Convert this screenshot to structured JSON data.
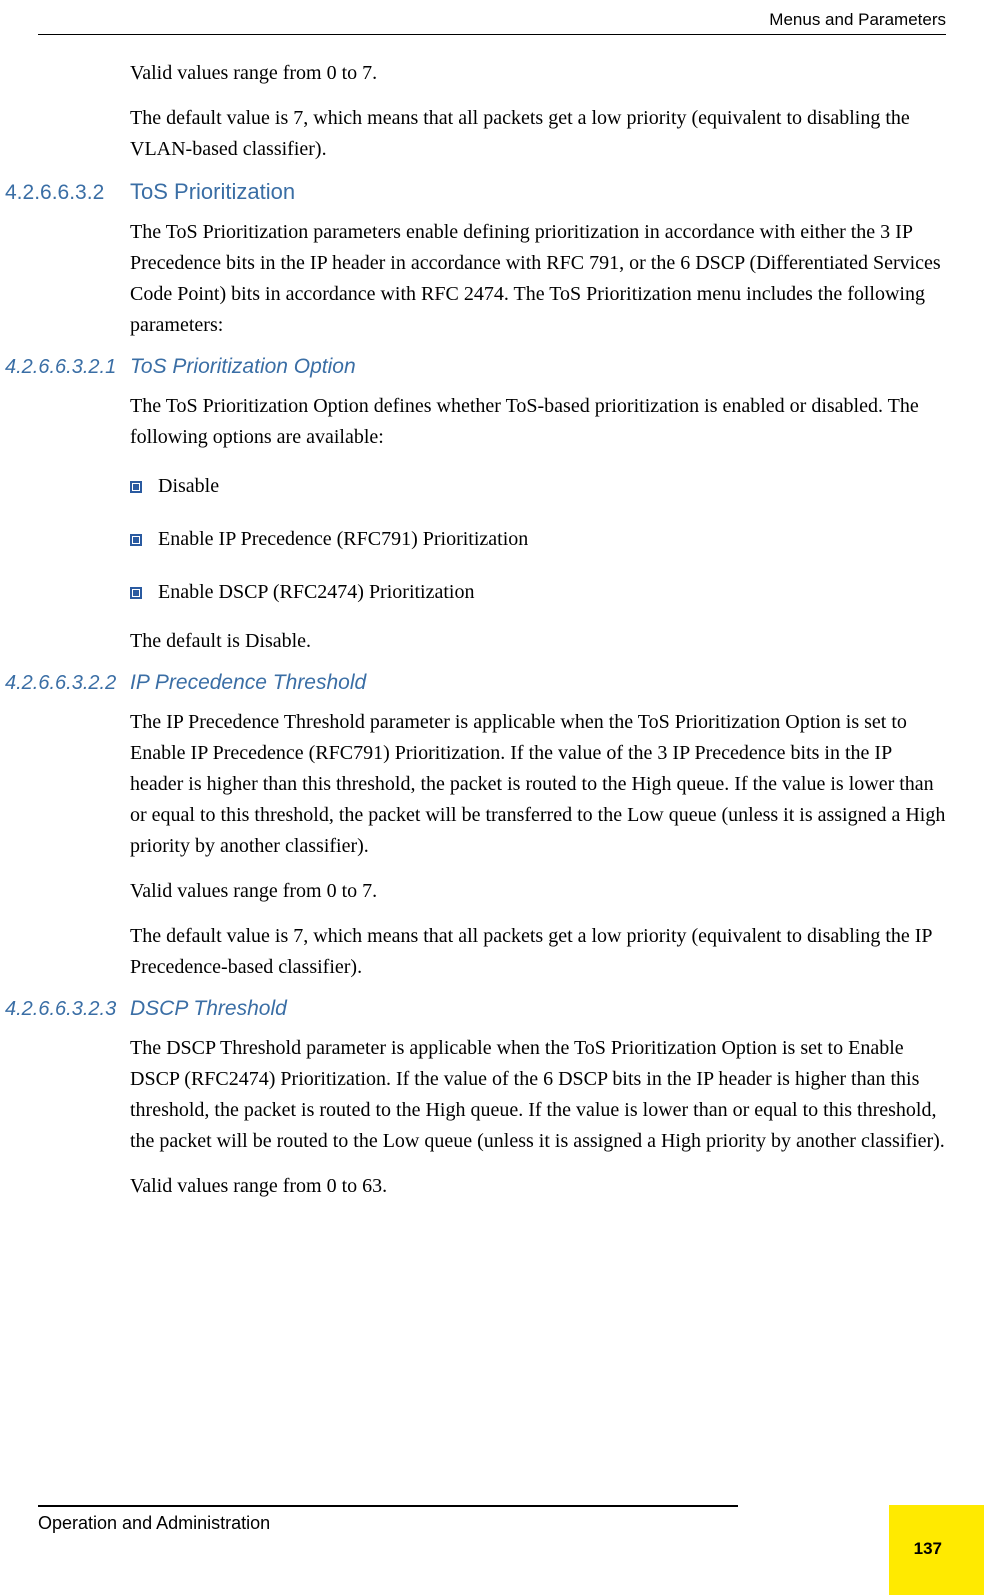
{
  "header": {
    "right": "Menus and Parameters"
  },
  "intro": {
    "p1": "Valid values range from 0 to 7.",
    "p2": "The default value is 7, which means that all packets get a low priority (equivalent to disabling the VLAN-based classifier)."
  },
  "sec1": {
    "num": "4.2.6.6.3.2",
    "title": "ToS Prioritization",
    "body": "The ToS Prioritization parameters enable defining prioritization in accordance with either the 3 IP Precedence bits in the IP header in accordance with RFC 791, or the 6 DSCP (Differentiated Services Code Point) bits in accordance with RFC 2474. The ToS Prioritization menu includes the following parameters:"
  },
  "sub1": {
    "num": "4.2.6.6.3.2.1",
    "title": "ToS Prioritization Option",
    "body": "The ToS Prioritization Option defines whether ToS-based prioritization is enabled or disabled. The following options are available:",
    "bullets": [
      "Disable",
      "Enable IP Precedence (RFC791) Prioritization",
      "Enable DSCP (RFC2474) Prioritization"
    ],
    "after": "The default is Disable."
  },
  "sub2": {
    "num": "4.2.6.6.3.2.2",
    "title": "IP Precedence Threshold",
    "p1": "The IP Precedence Threshold parameter is applicable when the ToS Prioritization Option is set to Enable IP Precedence (RFC791) Prioritization. If the value of the 3 IP Precedence bits in the IP header is higher than this threshold, the packet is routed to the High queue. If the value is lower than or equal to this threshold, the packet will be transferred to the Low queue (unless it is assigned a High priority by another classifier).",
    "p2": "Valid values range from 0 to 7.",
    "p3": "The default value is 7, which means that all packets get a low priority (equivalent to disabling the IP Precedence-based classifier)."
  },
  "sub3": {
    "num": "4.2.6.6.3.2.3",
    "title": "DSCP Threshold",
    "p1": "The DSCP Threshold parameter is applicable when the ToS Prioritization Option is set to Enable DSCP (RFC2474) Prioritization. If the value of the 6 DSCP bits in the IP header is higher than this threshold, the packet is routed to the High queue. If the value is lower than or equal to this threshold, the packet will be routed to the Low queue (unless it is assigned a High priority by another classifier).",
    "p2": "Valid values range from 0 to 63."
  },
  "footer": {
    "left": "Operation and Administration",
    "page": "137"
  }
}
